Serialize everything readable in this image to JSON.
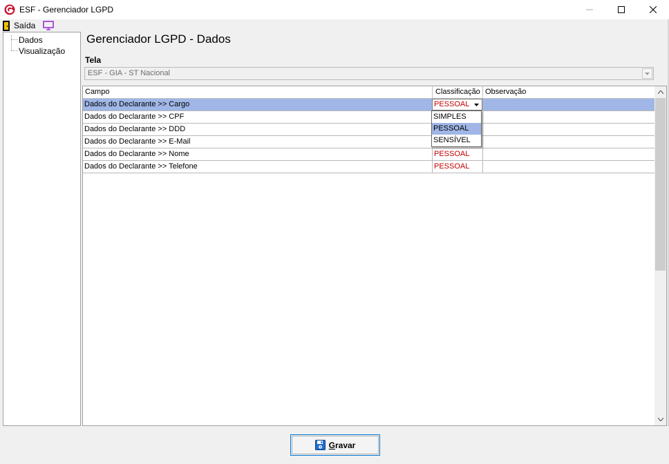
{
  "window": {
    "title": "ESF - Gerenciador LGPD",
    "app_icon": "esf-logo-icon",
    "controls": [
      "minimize-icon",
      "maximize-icon",
      "close-icon"
    ]
  },
  "menu": {
    "exit_label": "Saída",
    "exit_icon": "door-exit-icon",
    "screen_icon": "monitor-icon"
  },
  "tree": {
    "items": [
      {
        "label": "Dados"
      },
      {
        "label": "Visualização"
      }
    ]
  },
  "page": {
    "title": "Gerenciador LGPD - Dados",
    "tela_label": "Tela",
    "tela_value": "ESF - GIA - ST Nacional"
  },
  "grid": {
    "columns": [
      "Campo",
      "Classificação",
      "Observação"
    ],
    "rows": [
      {
        "campo": "Dados do Declarante >> Cargo",
        "classificacao": "PESSOAL",
        "observacao": "",
        "selected": true
      },
      {
        "campo": "Dados do Declarante >> CPF",
        "classificacao": "",
        "observacao": ""
      },
      {
        "campo": "Dados do Declarante >> DDD",
        "classificacao": "",
        "observacao": ""
      },
      {
        "campo": "Dados do Declarante >> E-Mail",
        "classificacao": "",
        "observacao": ""
      },
      {
        "campo": "Dados do Declarante >> Nome",
        "classificacao": "PESSOAL",
        "observacao": ""
      },
      {
        "campo": "Dados do Declarante >> Telefone",
        "classificacao": "PESSOAL",
        "observacao": ""
      }
    ],
    "editor_value": "PESSOAL",
    "dropdown_options": [
      "SIMPLES",
      "PESSOAL",
      "SENSÍVEL"
    ],
    "dropdown_highlighted": "PESSOAL",
    "classification_color": "#c00000",
    "selection_color": "#9fb6e6"
  },
  "footer": {
    "save_label_first": "G",
    "save_label_rest": "ravar",
    "save_icon": "floppy-disk-icon"
  }
}
